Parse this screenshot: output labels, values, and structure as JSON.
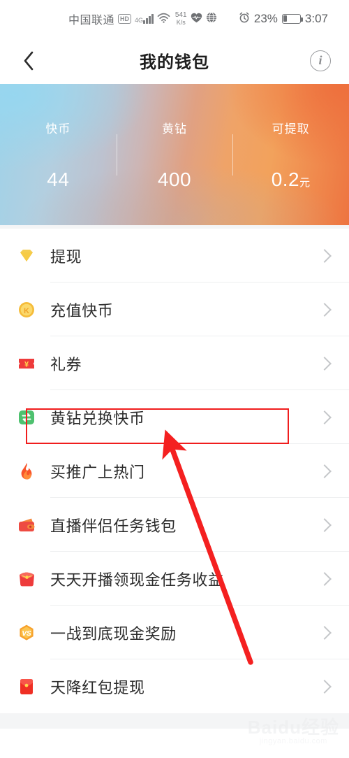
{
  "status_bar": {
    "carrier": "中国联通",
    "hd_badge": "HD",
    "network_type": "4G",
    "net_speed_value": "541",
    "net_speed_unit": "K/s",
    "heart_icon": "heart-icon",
    "globe_icon": "globe-icon",
    "alarm_icon": "alarm-clock-icon",
    "battery_percent": "23%",
    "battery_level": 23,
    "time": "3:07"
  },
  "navbar": {
    "back_icon": "back-chevron-icon",
    "title": "我的钱包",
    "info_icon": "info-icon",
    "info_glyph": "i"
  },
  "banner": {
    "gradient_start": "#9fd2e8",
    "gradient_end": "#ed7440",
    "stats": [
      {
        "label": "快币",
        "value": "44",
        "unit": ""
      },
      {
        "label": "黄钻",
        "value": "400",
        "unit": ""
      },
      {
        "label": "可提取",
        "value": "0.2",
        "unit": "元"
      }
    ]
  },
  "list": {
    "items": [
      {
        "label": "提现",
        "icon": "diamond-icon",
        "chevron": "chevron-right-icon"
      },
      {
        "label": "充值快币",
        "icon": "k-coin-icon",
        "chevron": "chevron-right-icon"
      },
      {
        "label": "礼券",
        "icon": "coupon-ticket-icon",
        "chevron": "chevron-right-icon"
      },
      {
        "label": "黄钻兑换快币",
        "icon": "exchange-icon",
        "chevron": "chevron-right-icon"
      },
      {
        "label": "买推广上热门",
        "icon": "flame-icon",
        "chevron": "chevron-right-icon"
      },
      {
        "label": "直播伴侣任务钱包",
        "icon": "wallet-icon",
        "chevron": "chevron-right-icon"
      },
      {
        "label": "天天开播领现金任务收益",
        "icon": "red-packet-open-icon",
        "chevron": "chevron-right-icon"
      },
      {
        "label": "一战到底现金奖励",
        "icon": "vs-hexagon-icon",
        "chevron": "chevron-right-icon"
      },
      {
        "label": "天降红包提现",
        "icon": "red-envelope-icon",
        "chevron": "chevron-right-icon"
      }
    ]
  },
  "annotations": {
    "highlight_color": "#f01d1d",
    "highlight_target": "黄钻兑换快币",
    "arrow_color": "#f42020"
  },
  "watermark": {
    "brand": "Baidu",
    "suffix": "经验",
    "url": "jingyan.baidu.com"
  }
}
